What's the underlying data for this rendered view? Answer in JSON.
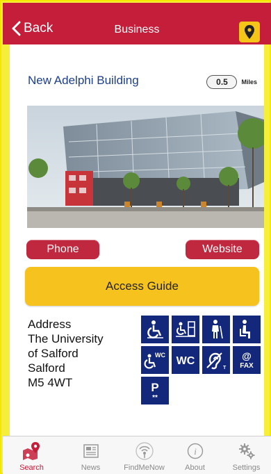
{
  "navbar": {
    "back_label": "Back",
    "title": "Business"
  },
  "venue": {
    "name": "New Adelphi Building",
    "distance_value": "0.5",
    "distance_unit": "Miles"
  },
  "actions": {
    "phone_label": "Phone",
    "website_label": "Website",
    "access_label": "Access Guide"
  },
  "address": {
    "lines": [
      "Address",
      "The University",
      "of Salford",
      "Salford",
      "M5 4WT"
    ]
  },
  "accessibility_icons": [
    {
      "icon": "wheelchair-access-icon"
    },
    {
      "icon": "wheelchair-lift-icon"
    },
    {
      "icon": "standing-person-icon"
    },
    {
      "icon": "seated-person-icon"
    },
    {
      "icon": "accessible-wc-icon",
      "text": "WC"
    },
    {
      "icon": "wc-icon",
      "text": "WC"
    },
    {
      "icon": "hearing-loop-icon",
      "text": "T"
    },
    {
      "icon": "email-fax-icon",
      "text_top": "@",
      "text_bottom": "FAX"
    },
    {
      "icon": "parking-icon",
      "text_top": "P",
      "text_bottom": "**"
    }
  ],
  "tabs": [
    {
      "label": "Search",
      "active": true
    },
    {
      "label": "News",
      "active": false
    },
    {
      "label": "FindMeNow",
      "active": false
    },
    {
      "label": "About",
      "active": false
    },
    {
      "label": "Settings",
      "active": false
    }
  ],
  "colors": {
    "brand_red": "#c41e3a",
    "access_yellow": "#f6c21e",
    "title_blue": "#1d3f8b",
    "icon_navy": "#13287a",
    "frame_yellow": "#f5ee3a"
  }
}
